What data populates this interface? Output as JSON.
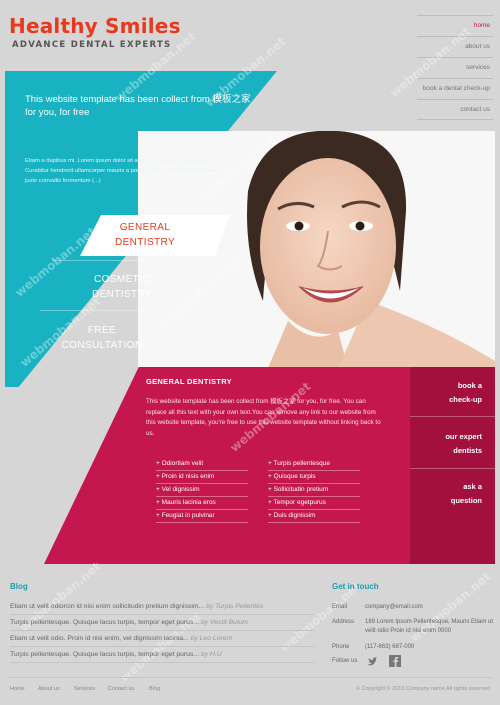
{
  "brand": {
    "name": "Healthy Smiles",
    "tagline": "ADVANCE DENTAL EXPERTS"
  },
  "nav": [
    {
      "label": "home",
      "active": true
    },
    {
      "label": "about us",
      "active": false
    },
    {
      "label": "services",
      "active": false
    },
    {
      "label": "book a dental check-up",
      "active": false
    },
    {
      "label": "contact us",
      "active": false
    }
  ],
  "hero": {
    "title": "This website template has been collect from 模板之家 for you, for free",
    "text": "Etiam a dapibus mi. Lorem ipsum dolor sit amet, consectetur adipiscing elit. Curabitur hendrerit ullamcorper mauris a porttitor. Nam mattis nulla sit amet justo convallis fermentum (...)",
    "services": [
      {
        "line1": "GENERAL",
        "line2": "DENTISTRY"
      },
      {
        "line1": "COSMETIC",
        "line2": "DENTISTRY"
      },
      {
        "line1": "FREE",
        "line2": "CONSULTATION"
      }
    ]
  },
  "general": {
    "title": "GENERAL DENTISTRY",
    "text": "This website template has been collect from 模板之家 for you, for free. You can replace all this text with your own text.You can remove any link to our website from this website template, you're free to use this website template without linking back to us.",
    "list_left": [
      "+ Odiortiam velit",
      "+ Proin id nisis enim",
      "+ Vel dignissim",
      "+ Mauris lacinia eros",
      "+ Feugiat in pulvinar"
    ],
    "list_right": [
      "+ Turpis pellentesque",
      "+ Quisque turpis",
      "+ Sollicitudin pretium",
      "+ Tempor egetpurus",
      "+ Duis dignissim"
    ]
  },
  "side": [
    {
      "line1": "book a",
      "line2": "check-up"
    },
    {
      "line1": "our expert",
      "line2": "dentists"
    },
    {
      "line1": "ask a",
      "line2": "question"
    }
  ],
  "blog": {
    "heading": "Blog",
    "posts": [
      {
        "text": "Etiam ut velit odiorcin id nisi enim sollicitudin pretium dignissim...",
        "by": "by Turpis Pellentes"
      },
      {
        "text": "Turpis pellentesque. Quisque lacus turpis, tempor eget purus...",
        "by": "by Vestit Bulum"
      },
      {
        "text": "Etiam ut velit odio. Proin id nisi enim, vel dignissim lacinia...",
        "by": "by Leo Lorem"
      },
      {
        "text": "Turpis pellentesque. Quisque lacus turpis, tempor eget purus...",
        "by": "by H.U"
      }
    ]
  },
  "contact": {
    "heading": "Get in touch",
    "email_label": "Email",
    "email": "company@email.com",
    "address_label": "Address",
    "address": "189 Lorem Ipsum Pellentesque, Mauris Etiam ut velit odio Proin id nisi enim 0000",
    "phone_label": "Phone",
    "phone": "(117-663) 687-000",
    "follow_label": "Follow us"
  },
  "footer": {
    "links": [
      "Home",
      "About us",
      "Services",
      "Contact us",
      "Blog"
    ],
    "copyright": "© Copyright © 2013 Company name All rights reserved"
  },
  "watermark": "webmoban.net",
  "colors": {
    "accent": "#e8391d",
    "teal": "#19b2c2",
    "magenta": "#c5174f",
    "magenta_dark": "#a3103f",
    "heading_teal": "#1a9eaf"
  }
}
